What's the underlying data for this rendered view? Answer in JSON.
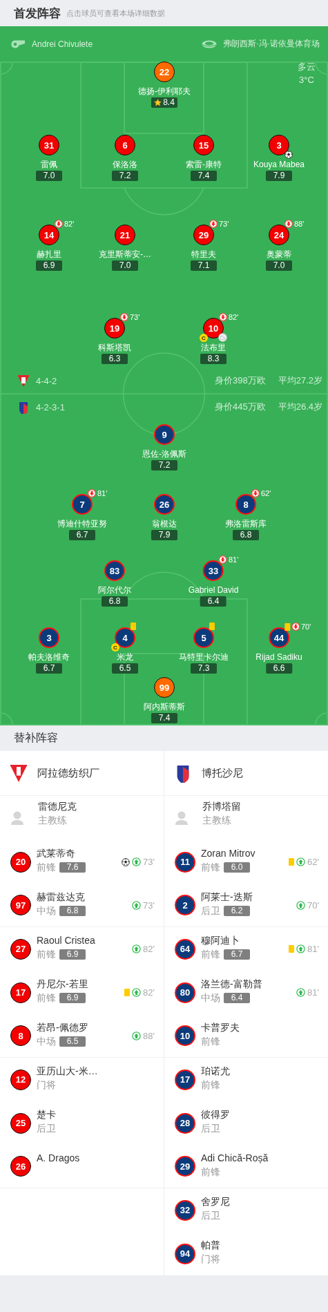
{
  "header": {
    "title": "首发阵容",
    "subtitle": "点击球员可查看本场详细数据"
  },
  "match_info": {
    "referee": "Andrei Chivulete",
    "venue": "弗朗西斯·冯·诺依曼体育场",
    "weather": "多云",
    "temperature": "3°C"
  },
  "teams": [
    {
      "formation": "4-4-2",
      "market_value": "身价398万欧",
      "average_age": "平均27.2岁",
      "lines": [
        {
          "players": [
            {
              "number": "22",
              "name": "德扬-伊利耶夫",
              "rating": "8.4",
              "kind": "goalkeeper",
              "badges": [
                {
                  "kind": "mvp"
                }
              ]
            }
          ]
        },
        {
          "players": [
            {
              "number": "31",
              "name": "雷佩",
              "rating": "7.0",
              "kind": "outfield"
            },
            {
              "number": "6",
              "name": "保洛洛",
              "rating": "7.2",
              "kind": "outfield"
            },
            {
              "number": "15",
              "name": "索雷-康特",
              "rating": "7.4",
              "kind": "outfield"
            },
            {
              "number": "3",
              "name": "Kouya Mabea",
              "rating": "7.9",
              "kind": "outfield",
              "badges": [
                {
                  "kind": "goal"
                }
              ]
            }
          ]
        },
        {
          "players": [
            {
              "number": "14",
              "name": "赫扎里",
              "rating": "6.9",
              "kind": "outfield",
              "badges": [
                {
                  "kind": "sub_off",
                  "minute": "82'"
                }
              ]
            },
            {
              "number": "21",
              "name": "克里斯蒂安-…",
              "rating": "7.0",
              "kind": "outfield"
            },
            {
              "number": "29",
              "name": "特里夫",
              "rating": "7.1",
              "kind": "outfield",
              "badges": [
                {
                  "kind": "sub_off",
                  "minute": "73'"
                }
              ]
            },
            {
              "number": "24",
              "name": "奥蒙蒂",
              "rating": "7.0",
              "kind": "outfield",
              "badges": [
                {
                  "kind": "sub_off",
                  "minute": "88'"
                }
              ]
            }
          ]
        },
        {
          "players": [
            {
              "number": "19",
              "name": "科斯塔凯",
              "rating": "6.3",
              "kind": "outfield",
              "badges": [
                {
                  "kind": "sub_off",
                  "minute": "73'"
                }
              ]
            },
            {
              "number": "10",
              "name": "法布里",
              "rating": "8.3",
              "kind": "outfield",
              "badges": [
                {
                  "kind": "sub_off",
                  "minute": "82'"
                },
                {
                  "kind": "captain",
                  "label": "C"
                },
                {
                  "kind": "assist"
                }
              ]
            }
          ]
        }
      ]
    },
    {
      "formation": "4-2-3-1",
      "market_value": "身价445万欧",
      "average_age": "平均26.4岁",
      "lines": [
        {
          "players": [
            {
              "number": "9",
              "name": "恩佐-洛佩斯",
              "rating": "7.2",
              "kind": "outfield"
            }
          ]
        },
        {
          "players": [
            {
              "number": "7",
              "name": "博迪什特亚努",
              "rating": "6.7",
              "kind": "outfield",
              "badges": [
                {
                  "kind": "sub_off",
                  "minute": "81'"
                }
              ]
            },
            {
              "number": "26",
              "name": "翁根达",
              "rating": "7.9",
              "kind": "outfield"
            },
            {
              "number": "8",
              "name": "弗洛雷斯库",
              "rating": "6.8",
              "kind": "outfield",
              "badges": [
                {
                  "kind": "sub_off",
                  "minute": "62'"
                }
              ]
            }
          ]
        },
        {
          "players": [
            {
              "number": "83",
              "name": "阿尔代尔",
              "rating": "6.8",
              "kind": "outfield"
            },
            {
              "number": "33",
              "name": "Gabriel David",
              "rating": "6.4",
              "kind": "outfield",
              "badges": [
                {
                  "kind": "sub_off",
                  "minute": "81'"
                }
              ]
            }
          ]
        },
        {
          "players": [
            {
              "number": "3",
              "name": "帕夫洛维奇",
              "rating": "6.7",
              "kind": "outfield"
            },
            {
              "number": "4",
              "name": "米龙",
              "rating": "6.5",
              "kind": "outfield",
              "badges": [
                {
                  "kind": "yellow_card"
                },
                {
                  "kind": "captain",
                  "label": "C"
                }
              ]
            },
            {
              "number": "5",
              "name": "马特里卡尔迪",
              "rating": "7.3",
              "kind": "outfield",
              "badges": [
                {
                  "kind": "yellow_card"
                }
              ]
            },
            {
              "number": "44",
              "name": "Rijad Sadiku",
              "rating": "6.6",
              "kind": "outfield",
              "badges": [
                {
                  "kind": "yellow_card"
                },
                {
                  "kind": "sub_off",
                  "minute": "70'"
                }
              ]
            }
          ]
        },
        {
          "players": [
            {
              "number": "99",
              "name": "阿内斯蒂斯",
              "rating": "7.4",
              "kind": "goalkeeper"
            }
          ]
        }
      ]
    }
  ],
  "substitutes": {
    "title": "替补阵容",
    "teams": [
      {
        "team_name": "阿拉德纺织厂",
        "coach": {
          "name": "雷德尼克",
          "role": "主教练"
        },
        "players": [
          {
            "number": "20",
            "name": "武莱蒂奇",
            "position": "前锋",
            "rating": "7.6",
            "events": [
              {
                "kind": "goal"
              },
              {
                "kind": "sub_on",
                "minute": "73'"
              }
            ]
          },
          {
            "number": "97",
            "name": "赫雷兹达克",
            "position": "中场",
            "rating": "6.8",
            "events": [
              {
                "kind": "sub_on",
                "minute": "73'"
              }
            ]
          },
          {
            "number": "27",
            "name": "Raoul Cristea",
            "position": "前锋",
            "rating": "6.9",
            "events": [
              {
                "kind": "sub_on",
                "minute": "82'"
              }
            ]
          },
          {
            "number": "17",
            "name": "丹尼尔-若里",
            "position": "前锋",
            "rating": "6.9",
            "events": [
              {
                "kind": "yellow_card"
              },
              {
                "kind": "sub_on",
                "minute": "82'"
              }
            ]
          },
          {
            "number": "8",
            "name": "若昂-佩德罗",
            "position": "中场",
            "rating": "6.5",
            "events": [
              {
                "kind": "sub_on",
                "minute": "88'"
              }
            ]
          },
          {
            "number": "12",
            "name": "亚历山大-米…",
            "position": "门将"
          },
          {
            "number": "25",
            "name": "楚卡",
            "position": "后卫"
          },
          {
            "number": "26",
            "name": "A. Dragos"
          }
        ]
      },
      {
        "team_name": "博托沙尼",
        "coach": {
          "name": "乔博塔留",
          "role": "主教练"
        },
        "players": [
          {
            "number": "11",
            "name": "Zoran Mitrov",
            "position": "前锋",
            "rating": "6.0",
            "events": [
              {
                "kind": "yellow_card"
              },
              {
                "kind": "sub_on",
                "minute": "62'"
              }
            ]
          },
          {
            "number": "2",
            "name": "阿莱士-迭斯",
            "position": "后卫",
            "rating": "6.2",
            "events": [
              {
                "kind": "sub_on",
                "minute": "70'"
              }
            ]
          },
          {
            "number": "64",
            "name": "穆阿迪卜",
            "position": "前锋",
            "rating": "6.7",
            "events": [
              {
                "kind": "yellow_card"
              },
              {
                "kind": "sub_on",
                "minute": "81'"
              }
            ]
          },
          {
            "number": "80",
            "name": "洛兰德-富勒普",
            "position": "中场",
            "rating": "6.4",
            "events": [
              {
                "kind": "sub_on",
                "minute": "81'"
              }
            ]
          },
          {
            "number": "10",
            "name": "卡普罗夫",
            "position": "前锋"
          },
          {
            "number": "17",
            "name": "珀诺尤",
            "position": "前锋"
          },
          {
            "number": "28",
            "name": "彼得罗",
            "position": "后卫"
          },
          {
            "number": "29",
            "name": "Adi Chică-Roșă",
            "position": "前锋"
          },
          {
            "number": "32",
            "name": "舍罗尼",
            "position": "后卫"
          },
          {
            "number": "94",
            "name": "帕普",
            "position": "门将"
          }
        ]
      }
    ]
  }
}
